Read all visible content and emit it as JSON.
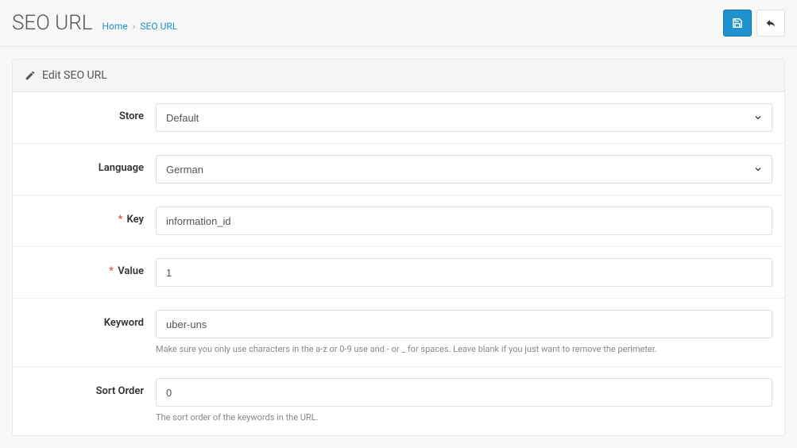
{
  "header": {
    "title": "SEO URL",
    "breadcrumb": {
      "home": "Home",
      "current": "SEO URL"
    }
  },
  "panel": {
    "title": "Edit SEO URL"
  },
  "form": {
    "store": {
      "label": "Store",
      "value": "Default"
    },
    "language": {
      "label": "Language",
      "value": "German"
    },
    "key": {
      "label": "Key",
      "value": "information_id"
    },
    "value": {
      "label": "Value",
      "value": "1"
    },
    "keyword": {
      "label": "Keyword",
      "value": "uber-uns",
      "help": "Make sure you only use characters in the a-z or 0-9 use and - or _ for spaces. Leave blank if you just want to remove the perimeter."
    },
    "sort_order": {
      "label": "Sort Order",
      "value": "0",
      "help": "The sort order of the keywords in the URL."
    }
  }
}
